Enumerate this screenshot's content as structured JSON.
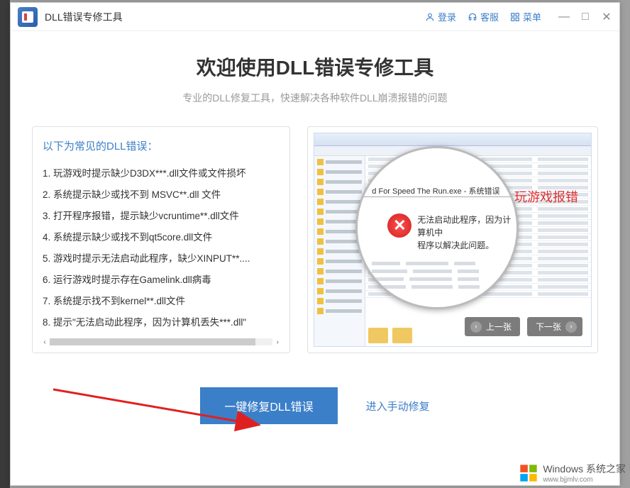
{
  "titlebar": {
    "title": "DLL错误专修工具",
    "login": "登录",
    "support": "客服",
    "menu": "菜单"
  },
  "header": {
    "title": "欢迎使用DLL错误专修工具",
    "subtitle": "专业的DLL修复工具，快速解决各种软件DLL崩溃报错的问题"
  },
  "left_panel": {
    "heading": "以下为常见的DLL错误：",
    "errors": [
      "1. 玩游戏时提示缺少D3DX***.dll文件或文件损坏",
      "2. 系统提示缺少或找不到 MSVC**.dll 文件",
      "3. 打开程序报错，提示缺少vcruntime**.dll文件",
      "4. 系统提示缺少或找不到qt5core.dll文件",
      "5. 游戏时提示无法启动此程序，缺少XINPUT**....",
      "6. 运行游戏时提示存在Gamelink.dll病毒",
      "7. 系统提示找不到kernel**.dll文件",
      "8. 提示\"无法启动此程序，因为计算机丢失***.dll\""
    ]
  },
  "right_panel": {
    "error_label": "玩游戏报错",
    "dialog_title": "d For Speed The Run.exe - 系统错误",
    "dialog_text1": "无法启动此程序，因为计算机中",
    "dialog_text2": "程序以解决此问题。",
    "nav_prev": "上一张",
    "nav_next": "下一张"
  },
  "actions": {
    "primary": "一键修复DLL错误",
    "secondary": "进入手动修复"
  },
  "watermark": {
    "brand_prefix": "Windows",
    "brand_suffix": "系统之家",
    "url": "www.bjjmlv.com"
  }
}
